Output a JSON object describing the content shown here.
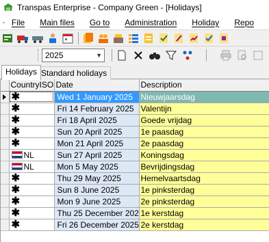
{
  "window": {
    "title": "Transpas Enterprise - Company Green - [Holidays]"
  },
  "menu": [
    "File",
    "Main files",
    "Go to",
    "Administration",
    "Holiday",
    "Repo"
  ],
  "toolbar_filter": {
    "year_value": "2025"
  },
  "tabs": [
    "Holidays",
    "Standard holidays"
  ],
  "grid": {
    "columns": [
      "CountryISO",
      "Date",
      "Description"
    ],
    "rows": [
      {
        "country": "",
        "country_icon": "asterisk-icon",
        "date": "Wed 1 January 2025",
        "description": "Nieuwjaarsdag",
        "selected": true
      },
      {
        "country": "",
        "country_icon": "asterisk-icon",
        "date": "Fri 14 February 2025",
        "description": "Valentijn"
      },
      {
        "country": "",
        "country_icon": "asterisk-icon",
        "date": "Fri 18 April 2025",
        "description": "Goede vrijdag"
      },
      {
        "country": "",
        "country_icon": "asterisk-icon",
        "date": "Sun 20 April 2025",
        "description": "1e paasdag"
      },
      {
        "country": "",
        "country_icon": "asterisk-icon",
        "date": "Mon 21 April 2025",
        "description": "2e paasdag"
      },
      {
        "country": "NL",
        "country_icon": "netherlands-flag-icon",
        "date": "Sun 27 April 2025",
        "description": "Koningsdag"
      },
      {
        "country": "NL",
        "country_icon": "netherlands-flag-icon",
        "date": "Mon 5 May 2025",
        "description": "Bevrijdingsdag"
      },
      {
        "country": "",
        "country_icon": "asterisk-icon",
        "date": "Thu 29 May 2025",
        "description": "Hemelvaartsdag"
      },
      {
        "country": "",
        "country_icon": "asterisk-icon",
        "date": "Sun 8 June 2025",
        "description": "1e pinksterdag"
      },
      {
        "country": "",
        "country_icon": "asterisk-icon",
        "date": "Mon 9 June 2025",
        "description": "2e pinksterdag"
      },
      {
        "country": "",
        "country_icon": "asterisk-icon",
        "date": "Thu 25 December 2025",
        "description": "1e kerstdag"
      },
      {
        "country": "",
        "country_icon": "asterisk-icon",
        "date": "Fri 26 December 2025",
        "description": "2e kerstdag"
      }
    ]
  },
  "colors": {
    "date_cell": "#dde8f6",
    "description_cell": "#ffff99",
    "selected_date": "#3399ff",
    "selected_description": "#7fb8b0"
  }
}
